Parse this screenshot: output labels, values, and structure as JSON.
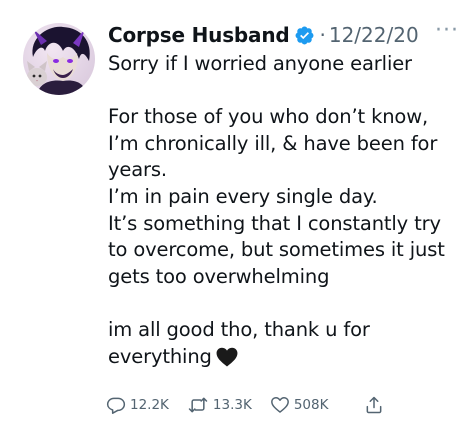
{
  "tweet": {
    "author_name": "Corpse Husband",
    "verified": true,
    "date": "12/22/20",
    "more_glyph": "···",
    "lines": [
      "Sorry if I worried anyone earlier",
      "",
      "For those of you who don’t know,",
      "I’m chronically ill, & have been for",
      "years.",
      "I’m in pain every single day.",
      "It’s something that I constantly try",
      "to overcome, but sometimes it just",
      "gets too overwhelming",
      "",
      "im all good tho, thank u for",
      "everything"
    ],
    "emoji": "black-heart",
    "stats": {
      "replies": "12.2K",
      "retweets": "13.3K",
      "likes": "508K"
    }
  },
  "colors": {
    "verified_blue": "#1d9bf0",
    "secondary_text": "#536471",
    "primary_text": "#0f1419"
  }
}
